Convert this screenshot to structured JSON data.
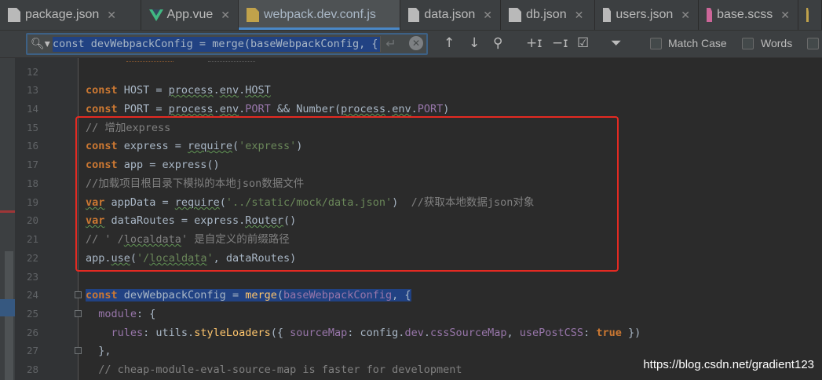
{
  "tabs": [
    {
      "label": "package.json",
      "icon": "json-file-icon",
      "active": false
    },
    {
      "label": "App.vue",
      "icon": "vue-file-icon",
      "active": false
    },
    {
      "label": "webpack.dev.conf.js",
      "icon": "js-file-icon",
      "active": true
    },
    {
      "label": "data.json",
      "icon": "js-file-icon",
      "active": false
    },
    {
      "label": "db.json",
      "icon": "js-file-icon",
      "active": false
    },
    {
      "label": "users.json",
      "icon": "js-file-icon",
      "active": false
    },
    {
      "label": "base.scss",
      "icon": "sass-file-icon",
      "active": false
    }
  ],
  "search": {
    "query": "const devWebpackConfig = merge(baseWebpackConfig, {",
    "match_case_label": "Match Case",
    "words_label": "Words"
  },
  "lines": [
    {
      "n": "12"
    },
    {
      "n": "13"
    },
    {
      "n": "14"
    },
    {
      "n": "15"
    },
    {
      "n": "16"
    },
    {
      "n": "17"
    },
    {
      "n": "18"
    },
    {
      "n": "19"
    },
    {
      "n": "20"
    },
    {
      "n": "21"
    },
    {
      "n": "22"
    },
    {
      "n": "23"
    },
    {
      "n": "24"
    },
    {
      "n": "25"
    },
    {
      "n": "26"
    },
    {
      "n": "27"
    },
    {
      "n": "28"
    }
  ],
  "code": {
    "l13": [
      "const",
      " HOST = ",
      "process",
      ".",
      "env",
      ".",
      "HOST"
    ],
    "l14": [
      "const",
      " PORT = ",
      "process",
      ".",
      "env",
      ".",
      "PORT",
      " && Number(",
      "process",
      ".",
      "env",
      ".",
      "PORT",
      ")"
    ],
    "l15": "// 增加express",
    "l16": [
      "const",
      " express = ",
      "require",
      "(",
      "'express'",
      ")"
    ],
    "l17": [
      "const",
      " app = express()"
    ],
    "l18": "//加载项目根目录下模拟的本地json数据文件",
    "l19": [
      "var",
      " appData = ",
      "require",
      "(",
      "'../static/mock/data.json'",
      ")  ",
      "//获取本地数据json对象"
    ],
    "l20": [
      "var",
      " dataRoutes = express.",
      "Router",
      "()"
    ],
    "l21": [
      "// ' /",
      "localdata",
      "' 是自定义的前缀路径"
    ],
    "l22": [
      "app.",
      "use",
      "(",
      "'/",
      "localdata",
      "'",
      ", dataRoutes)"
    ],
    "l24": [
      "const",
      " devWebpackConfig = ",
      "merge",
      "(",
      "baseWebpackConfig",
      ", {"
    ],
    "l25": [
      "  ",
      "module",
      ": {"
    ],
    "l26": [
      "    ",
      "rules",
      ": utils.",
      "styleLoaders",
      "({ ",
      "sourceMap",
      ": config.",
      "dev",
      ".",
      "cssSourceMap",
      ", ",
      "usePostCSS",
      ": ",
      "true",
      " })"
    ],
    "l27": "  },",
    "l28": "  // cheap-module-eval-source-map is faster for development"
  },
  "watermark": "https://blog.csdn.net/gradient123",
  "colors": {
    "keyword": "#cc7832",
    "comment": "#808080",
    "string": "#6a8759",
    "field": "#9876aa",
    "function": "#ffc66d",
    "highlight_box": "#e42a22"
  }
}
